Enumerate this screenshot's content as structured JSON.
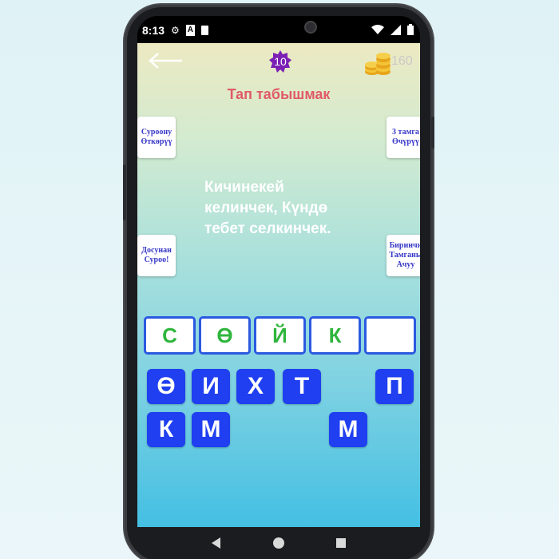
{
  "statusbar": {
    "time": "8:13",
    "left_icons": [
      "gear-icon",
      "a-icon",
      "sim-icon"
    ],
    "right_icons": [
      "wifi-icon",
      "signal-icon",
      "battery-icon"
    ]
  },
  "header": {
    "level": "10",
    "coins": "160"
  },
  "title": "Тап табышмак",
  "hints": [
    {
      "name": "skip-question",
      "text": "Суроону Өткөрүү"
    },
    {
      "name": "remove-3-letters",
      "text": "3 тамга Өчүрүү"
    },
    {
      "name": "ask-friend",
      "text": "Досунан Суроо!"
    },
    {
      "name": "open-first-letter",
      "text": "Биринчи Тамганы Ачуу"
    }
  ],
  "riddle": "Кичинекей келинчек, Күндө тебет селкинчек.",
  "answer": [
    "С",
    "Ө",
    "Й",
    "К",
    ""
  ],
  "keys": [
    {
      "label": "Ө"
    },
    {
      "label": "И"
    },
    {
      "label": "Х"
    },
    {
      "label": "Т"
    },
    {
      "label": "П"
    },
    {
      "label": "К"
    },
    {
      "label": "М"
    },
    {
      "label": "М"
    }
  ],
  "colors": {
    "title": "#e05a67",
    "key": "#1f3ff0",
    "answer_border": "#2b59e0",
    "answer_text": "#2fb53d",
    "hint_text": "#3838c8",
    "level_badge": "#7b1fb5"
  },
  "navbar": [
    "back-triangle-icon",
    "home-circle-icon",
    "recents-square-icon"
  ]
}
